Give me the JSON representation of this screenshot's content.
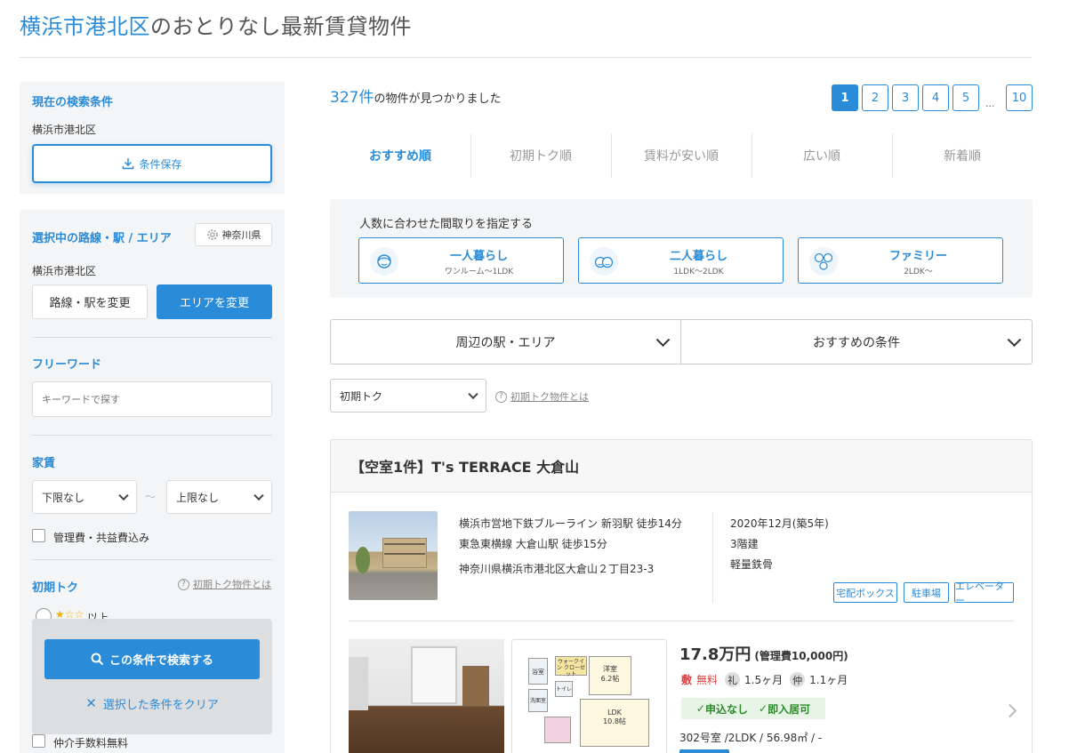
{
  "header": {
    "area": "横浜市港北区",
    "rest": "のおとりなし最新賃貸物件"
  },
  "sidebar": {
    "current": {
      "title": "現在の検索条件",
      "value": "横浜市港北区",
      "save_label": "条件保存"
    },
    "route": {
      "title": "選択中の路線・駅 / エリア",
      "pref_label": "神奈川県",
      "value": "横浜市港北区",
      "change_station": "路線・駅を変更",
      "change_area": "エリアを変更"
    },
    "freeword": {
      "title": "フリーワード",
      "placeholder": "キーワードで探す"
    },
    "rent": {
      "title": "家賃",
      "min": "下限なし",
      "tilde": "〜",
      "max": "上限なし",
      "include_fee": "管理費・共益費込み"
    },
    "shoki": {
      "title": "初期トク",
      "help": "初期トク物件とは",
      "partial": "以上"
    },
    "search_button": "この条件で検索する",
    "clear_button": "選択した条件をクリア",
    "agent_free": "仲介手数料無料"
  },
  "results": {
    "count": "327件",
    "count_suffix": "の物件が見つかりました",
    "pages": [
      "1",
      "2",
      "3",
      "4",
      "5"
    ],
    "ellipsis": "...",
    "last_page": "10"
  },
  "sort_tabs": [
    "おすすめ順",
    "初期トク順",
    "賃料が安い順",
    "広い順",
    "新着順"
  ],
  "people": {
    "title": "人数に合わせた間取りを指定する",
    "options": [
      {
        "label": "一人暮らし",
        "sub": "ワンルーム〜1LDK"
      },
      {
        "label": "二人暮らし",
        "sub": "1LDK〜2LDK"
      },
      {
        "label": "ファミリー",
        "sub": "2LDK〜"
      }
    ]
  },
  "filters": {
    "station_area": "周辺の駅・エリア",
    "recommended": "おすすめの条件",
    "shoki_select": "初期トク",
    "shoki_help": "初期トク物件とは"
  },
  "property": {
    "name": "【空室1件】T's TERRACE 大倉山",
    "access": [
      "横浜市営地下鉄ブルーライン 新羽駅 徒歩14分",
      "東急東横線 大倉山駅 徒歩15分"
    ],
    "address": "神奈川県横浜市港北区大倉山２丁目23-3",
    "built": "2020年12月(築5年)",
    "floors": "3階建",
    "structure": "軽量鉄骨",
    "tags": [
      "宅配ボックス",
      "駐車場",
      "エレベーター"
    ],
    "room": {
      "rent": "17.8万円",
      "fee": "(管理費10,000円)",
      "shiki_badge": "敷",
      "shiki": "無料",
      "rei_badge": "礼",
      "rei": "1.5ヶ月",
      "chu_badge": "仲",
      "chu": "1.1ヶ月",
      "badges": [
        "申込なし",
        "即入居可"
      ],
      "detail": "302号室 /2LDK / 56.98㎡ / -",
      "floorplan": {
        "room1": "洋室",
        "room1_size": "6.2帖",
        "ldk": "LDK",
        "ldk_size": "10.8帖",
        "wic": "ウォークイン クローゼット",
        "toilet": "トイレ",
        "wash": "洗面室",
        "bath": "浴室"
      }
    }
  }
}
